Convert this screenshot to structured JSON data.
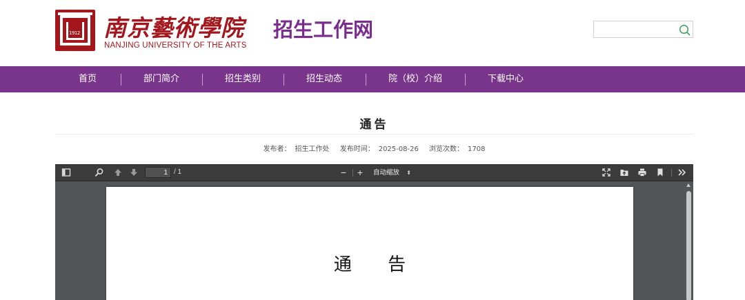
{
  "header": {
    "logo_cn": "南京藝術學院",
    "logo_en": "NANJING UNIVERSITY OF THE ARTS",
    "seal_year": "1912",
    "site_title": "招生工作网",
    "search": {
      "value": "",
      "placeholder": ""
    },
    "search_icon": "search-icon"
  },
  "nav": {
    "items": [
      {
        "label": "首页"
      },
      {
        "label": "部门简介"
      },
      {
        "label": "招生类别"
      },
      {
        "label": "招生动态"
      },
      {
        "label": "院（校）介绍"
      },
      {
        "label": "下载中心"
      }
    ]
  },
  "article": {
    "title": "通告",
    "publisher_label": "发布者：",
    "publisher": "招生工作处",
    "time_label": "发布时间：",
    "time": "2025-08-26",
    "views_label": "浏览次数：",
    "views": "1708"
  },
  "pdf_viewer": {
    "page_current": "1",
    "page_count": "/ 1",
    "zoom_out": "−",
    "zoom_in": "+",
    "zoom_value": "自动缩放",
    "page_heading": "通 告"
  },
  "colors": {
    "brand_red": "#a3161c",
    "brand_purple": "#79358b",
    "viewer_bg": "#525659",
    "toolbar_bg": "#3b3b3b"
  }
}
